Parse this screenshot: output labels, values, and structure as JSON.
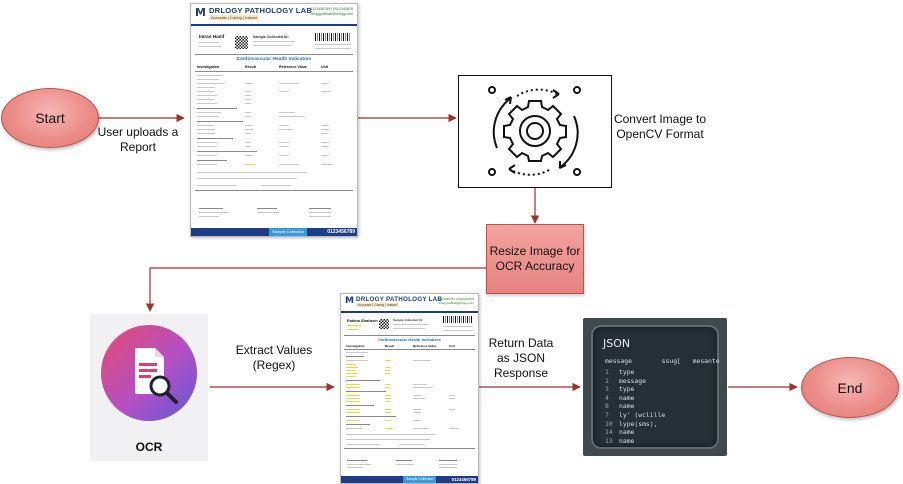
{
  "nodes": {
    "start": "Start",
    "end": "End",
    "convert": "Convert Image to OpenCV Format",
    "resize": "Resize Image for OCR Accuracy",
    "ocr": "OCR"
  },
  "edges": {
    "upload": "User uploads a Report",
    "extract": "Extract Values (Regex)",
    "return": "Return Data as JSON Response"
  },
  "report1": {
    "lab_name": "DRLOGY PATHOLOGY LAB",
    "tagline": "Accurate | Caring | Instant",
    "contact": "0123456789 | 0912345678\ndrlogypathlab@drlogy.com",
    "patient": "Imran Hanif",
    "section_title": "Cardiovascular Health Indicators",
    "headers": [
      "Investigation",
      "Result",
      "Reference Value",
      "Unit"
    ],
    "sample_label": "Sample Collected At:",
    "footer_tag": "Sample Collection",
    "phone": "0123456789"
  },
  "report2": {
    "lab_name": "DRLOGY PATHOLOGY LAB",
    "tagline": "Accurate | Caring | Instant",
    "contact": "0123456789 | 0912345678\ndrlogypathlab@drlogy.com",
    "patient": "Fatima Shaheen",
    "section_title": "Cardiovascular Health Indicators",
    "headers": [
      "Investigation",
      "Result",
      "Reference Value",
      "Unit"
    ],
    "sample_label": "Sample Collected At:",
    "footer_tag": "Sample Collection",
    "phone": "0123456789"
  },
  "json_panel": {
    "title": "JSON",
    "header_keys": "message",
    "header_mid": "ssug[",
    "header_right": "mesante",
    "rows": [
      {
        "num": "1",
        "text": "type"
      },
      {
        "num": "2",
        "text": "message"
      },
      {
        "num": "3",
        "text": "type"
      },
      {
        "num": "4",
        "text": "name"
      },
      {
        "num": "8",
        "text": "name"
      },
      {
        "num": "7",
        "text": "ly' (wclille"
      },
      {
        "num": "10",
        "text": "lype(sms),"
      },
      {
        "num": "14",
        "text": "name"
      },
      {
        "num": "13",
        "text": "name"
      }
    ]
  },
  "colors": {
    "arrow": "#a0302c",
    "node_fill": "#ec8d8a",
    "node_border": "#b85450"
  }
}
